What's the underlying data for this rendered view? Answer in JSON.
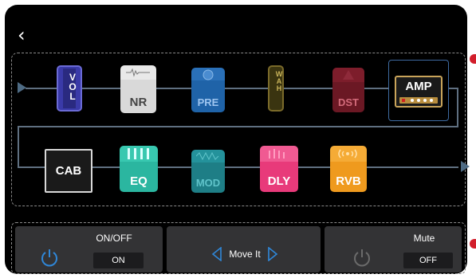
{
  "header": {
    "back_glyph": "‹"
  },
  "chain": {
    "row1": [
      {
        "label": "VOL",
        "kind": "volume"
      },
      {
        "label": "NR",
        "kind": "noise-reduction"
      },
      {
        "label": "PRE",
        "kind": "preamp"
      },
      {
        "label": "WAH",
        "kind": "wah"
      },
      {
        "label": "DST",
        "kind": "distortion"
      },
      {
        "label": "AMP",
        "kind": "amp",
        "selected": true
      }
    ],
    "row2": [
      {
        "label": "CAB",
        "kind": "cabinet"
      },
      {
        "label": "EQ",
        "kind": "equalizer"
      },
      {
        "label": "MOD",
        "kind": "modulation"
      },
      {
        "label": "DLY",
        "kind": "delay"
      },
      {
        "label": "RVB",
        "kind": "reverb"
      }
    ]
  },
  "controls": {
    "onoff": {
      "title": "ON/OFF",
      "value": "ON"
    },
    "move": {
      "label": "Move It"
    },
    "mute": {
      "title": "Mute",
      "value": "OFF"
    }
  },
  "colors": {
    "vol": "#3a3aa8",
    "nr": "#d9d9d9",
    "pre": "#1f63a8",
    "wah": "#7a6a2a",
    "dst": "#6b1824",
    "amp_frame": "#3e6aa0",
    "eq": "#2bb6a0",
    "mod": "#1e7e86",
    "dly": "#e83a7a",
    "rvb": "#ef9a1e",
    "accent_blue": "#2f87d8"
  }
}
